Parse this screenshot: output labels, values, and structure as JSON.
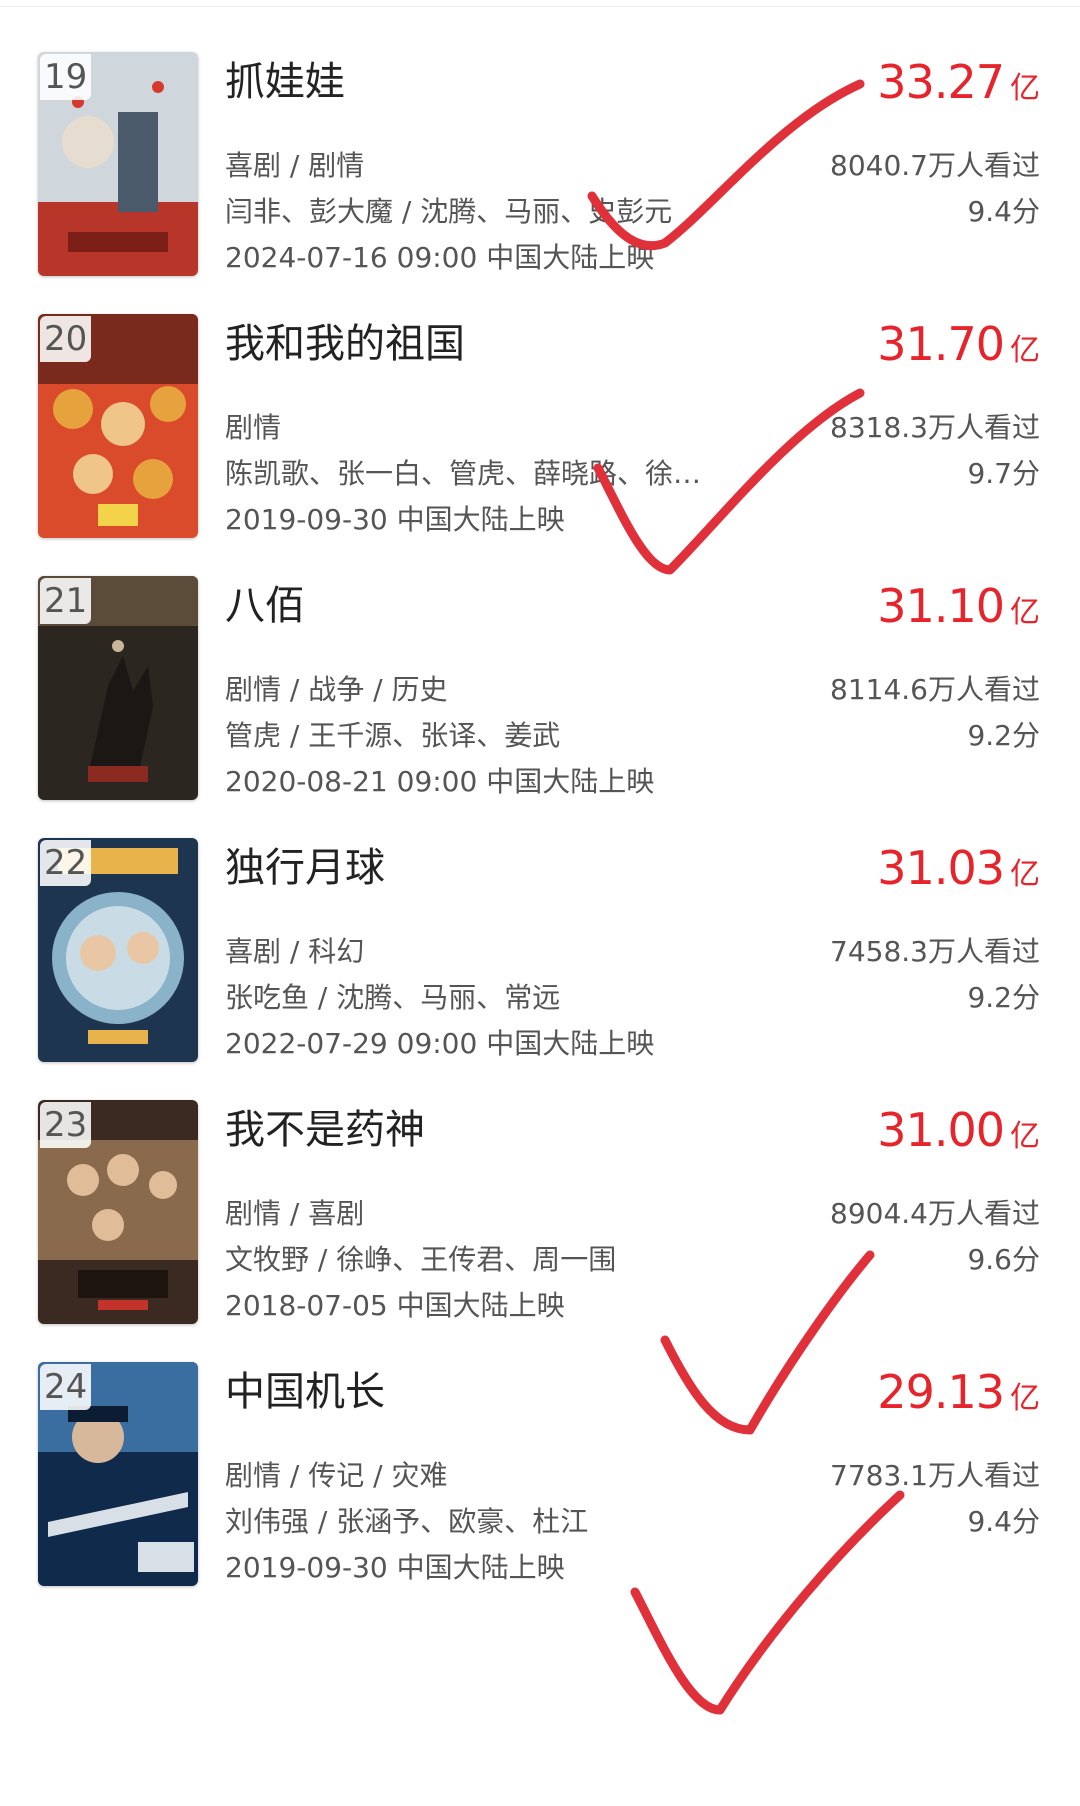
{
  "box_unit": "亿",
  "movies": [
    {
      "rank": "19",
      "title": "抓娃娃",
      "genre": "喜剧 / 剧情",
      "cast": "闫非、彭大魔 / 沈腾、马丽、史彭元",
      "release": "2024-07-16 09:00 中国大陆上映",
      "box_office": "33.27",
      "viewers": "8040.7万人看过",
      "score": "9.4分",
      "poster_colors": [
        "#cfd6dc",
        "#e7dcd0",
        "#b8352a"
      ]
    },
    {
      "rank": "20",
      "title": "我和我的祖国",
      "genre": "剧情",
      "cast": "陈凯歌、张一白、管虎、薛晓路、徐…",
      "release": "2019-09-30 中国大陆上映",
      "box_office": "31.70",
      "viewers": "8318.3万人看过",
      "score": "9.7分",
      "poster_colors": [
        "#d94b2b",
        "#e6a23c",
        "#7a2a1c"
      ]
    },
    {
      "rank": "21",
      "title": "八佰",
      "genre": "剧情 / 战争 / 历史",
      "cast": "管虎 / 王千源、张译、姜武",
      "release": "2020-08-21 09:00 中国大陆上映",
      "box_office": "31.10",
      "viewers": "8114.6万人看过",
      "score": "9.2分",
      "poster_colors": [
        "#2b2620",
        "#5b4c3a",
        "#1a1714"
      ]
    },
    {
      "rank": "22",
      "title": "独行月球",
      "genre": "喜剧 / 科幻",
      "cast": "张吃鱼 / 沈腾、马丽、常远",
      "release": "2022-07-29 09:00 中国大陆上映",
      "box_office": "31.03",
      "viewers": "7458.3万人看过",
      "score": "9.2分",
      "poster_colors": [
        "#1e3550",
        "#8ab2c9",
        "#e7b34a"
      ]
    },
    {
      "rank": "23",
      "title": "我不是药神",
      "genre": "剧情 / 喜剧",
      "cast": "文牧野 / 徐峥、王传君、周一围",
      "release": "2018-07-05 中国大陆上映",
      "box_office": "31.00",
      "viewers": "8904.4万人看过",
      "score": "9.6分",
      "poster_colors": [
        "#3a2a22",
        "#8a6a4c",
        "#c2332b"
      ]
    },
    {
      "rank": "24",
      "title": "中国机长",
      "genre": "剧情 / 传记 / 灾难",
      "cast": "刘伟强 / 张涵予、欧豪、杜江",
      "release": "2019-09-30 中国大陆上映",
      "box_office": "29.13",
      "viewers": "7783.1万人看过",
      "score": "9.4分",
      "poster_colors": [
        "#0f2a4a",
        "#3b6ea0",
        "#d9dfe6"
      ]
    }
  ],
  "annotation_color": "#e0303a"
}
